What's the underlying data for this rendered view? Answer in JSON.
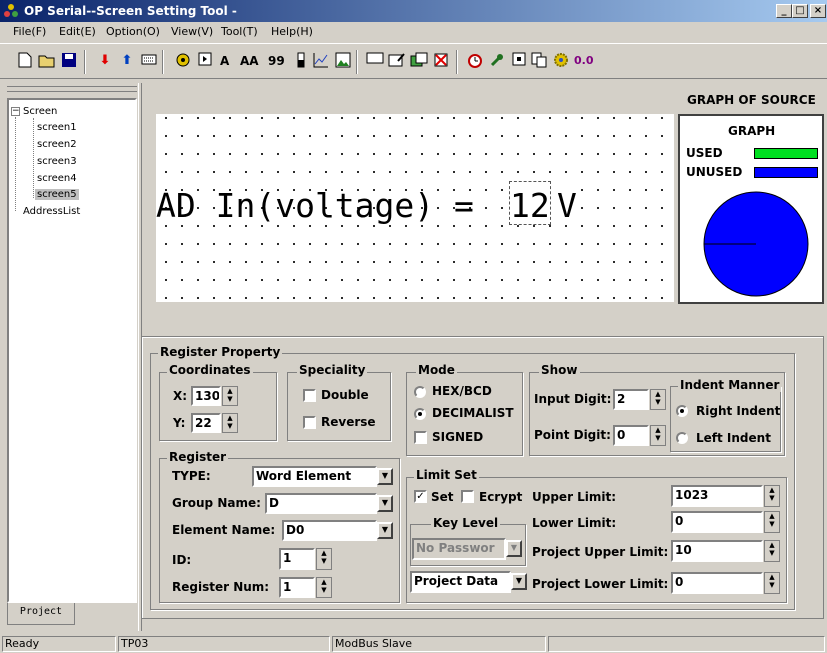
{
  "window": {
    "title": "OP Serial--Screen Setting Tool -",
    "min": "_",
    "max": "□",
    "close": "×"
  },
  "menu": [
    "File(F)",
    "Edit(E)",
    "Option(O)",
    "View(V)",
    "Tool(T)",
    "Help(H)"
  ],
  "toolbar": {
    "text_a": "A",
    "text_aa": "AA",
    "text_99": "99",
    "zoom": "0.0"
  },
  "tree": {
    "root": "Screen",
    "screens": [
      "screen1",
      "screen2",
      "screen3",
      "screen4",
      "screen5"
    ],
    "address": "AddressList",
    "tab": "Project"
  },
  "canvas": {
    "prefix": "AD In(voltage) =",
    "value": "12",
    "unit": "V"
  },
  "graph": {
    "header": "GRAPH OF SOURCE",
    "title": "GRAPH",
    "used": "USED",
    "unused": "UNUSED",
    "used_color": "#00e020",
    "unused_color": "#0000ff"
  },
  "reg": {
    "title": "Register Property",
    "coords": {
      "title": "Coordinates",
      "x_label": "X:",
      "x": "130",
      "y_label": "Y:",
      "y": "22"
    },
    "speciality": {
      "title": "Speciality",
      "double": "Double",
      "reverse": "Reverse"
    },
    "mode": {
      "title": "Mode",
      "hex": "HEX/BCD",
      "dec": "DECIMALIST",
      "signed": "SIGNED"
    },
    "show": {
      "title": "Show",
      "input_label": "Input Digit:",
      "input": "2",
      "point_label": "Point Digit:",
      "point": "0"
    },
    "indent": {
      "title": "Indent Manner",
      "right": "Right Indent",
      "left": "Left Indent"
    },
    "register": {
      "title": "Register",
      "type_label": "TYPE:",
      "type": "Word Element",
      "group_label": "Group Name:",
      "group": "D",
      "element_label": "Element Name:",
      "element": "D0",
      "id_label": "ID:",
      "id": "1",
      "num_label": "Register Num:",
      "num": "1"
    },
    "limit": {
      "title": "Limit Set",
      "set": "Set",
      "ecrypt": "Ecrypt",
      "upper_label": "Upper Limit:",
      "upper": "1023",
      "lower_label": "Lower Limit:",
      "lower": "0",
      "pupper_label": "Project Upper Limit:",
      "pupper": "10",
      "plower_label": "Project Lower Limit:",
      "plower": "0",
      "key_title": "Key Level",
      "key_value": "No Passwor",
      "data_select": "Project Data"
    }
  },
  "status": {
    "ready": "Ready",
    "device": "TP03",
    "protocol": "ModBus Slave"
  }
}
